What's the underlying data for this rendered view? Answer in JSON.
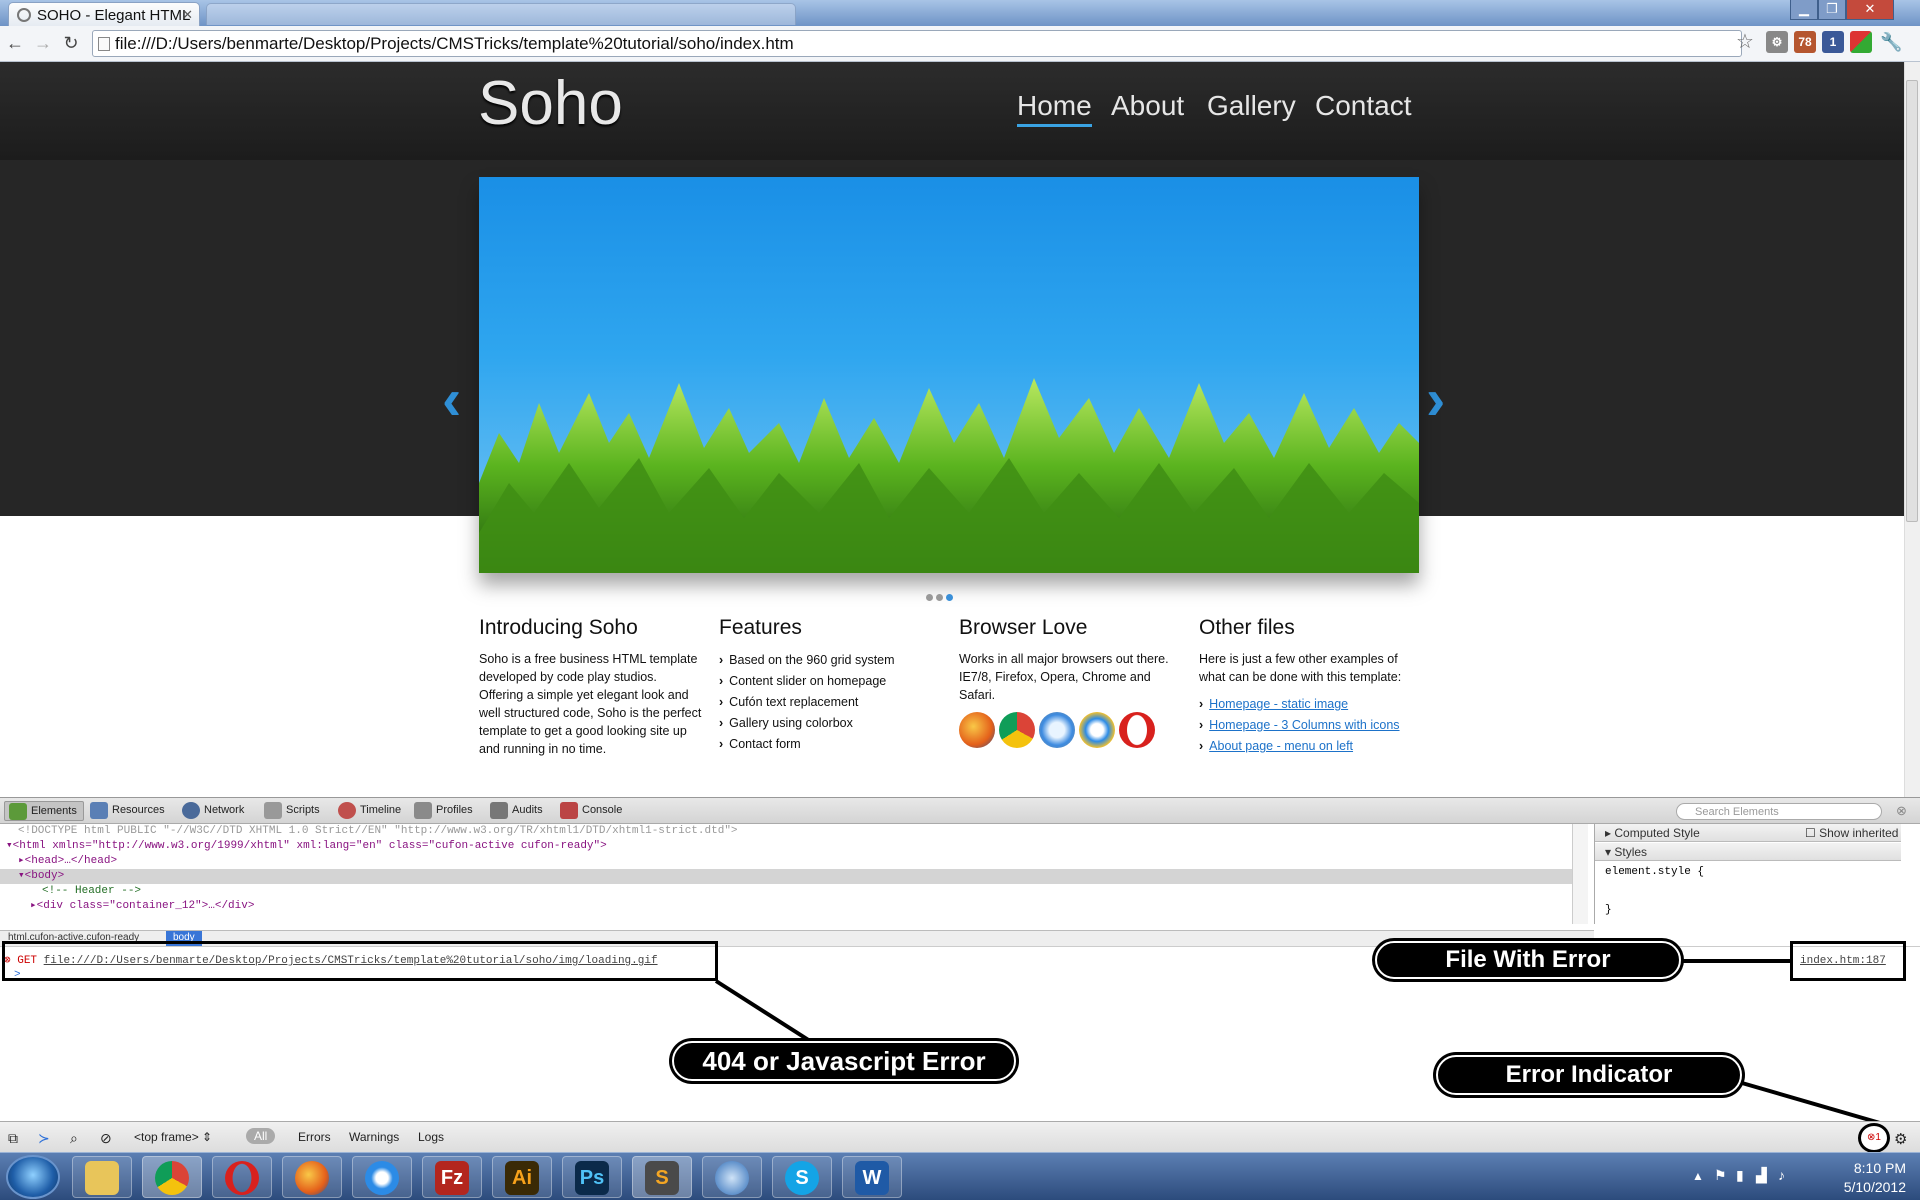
{
  "browser": {
    "tabs": [
      {
        "title": "SOHO - Elegant HTML"
      },
      {
        "title": ""
      }
    ],
    "window_controls": [
      "minimize",
      "maximize",
      "close"
    ],
    "url": "file:///D:/Users/benmarte/Desktop/Projects/CMSTricks/template%20tutorial/soho/index.htm",
    "extensions": [
      {
        "icon": "gear-icon"
      },
      {
        "icon": "extension-icon",
        "badge": "78"
      },
      {
        "icon": "facebook-icon",
        "badge": "1"
      },
      {
        "icon": "extension-icon"
      },
      {
        "icon": "wrench-icon"
      }
    ]
  },
  "site": {
    "logo": "Soho",
    "nav": [
      "Home",
      "About",
      "Gallery",
      "Contact"
    ],
    "columns": [
      {
        "title": "Introducing Soho",
        "text": "Soho is a free business HTML template developed by code play studios. Offering a simple yet elegant look and well structured code, Soho is the perfect template to get a good looking site up and running in no time."
      },
      {
        "title": "Features",
        "items": [
          "Based on the 960 grid system",
          "Content slider on homepage",
          "Cufón text replacement",
          "Gallery using colorbox",
          "Contact form"
        ]
      },
      {
        "title": "Browser Love",
        "text": "Works in all major browsers out there. IE7/8, Firefox, Opera, Chrome and Safari.",
        "browsers": [
          "firefox-icon",
          "chrome-icon",
          "safari-icon",
          "ie-icon",
          "opera-icon"
        ]
      },
      {
        "title": "Other files",
        "text": "Here is just a few other examples of what can be done with this template:",
        "links": [
          "Homepage - static image",
          "Homepage - 3 Columns with icons",
          "About page - menu on left"
        ]
      }
    ]
  },
  "devtools": {
    "tabs": [
      "Elements",
      "Resources",
      "Network",
      "Scripts",
      "Timeline",
      "Profiles",
      "Audits",
      "Console"
    ],
    "search_placeholder": "Search Elements",
    "dom": {
      "doctype": "<!DOCTYPE html PUBLIC \"-//W3C//DTD XHTML 1.0 Strict//EN\" \"http://www.w3.org/TR/xhtml1/DTD/xhtml1-strict.dtd\">",
      "html_open": "<html xmlns=\"http://www.w3.org/1999/xhtml\" xml:lang=\"en\" class=\"cufon-active cufon-ready\">",
      "head": "<head>…</head>",
      "body": "<body>",
      "comment": "<!-- Header -->",
      "div": "<div class=\"container_12\">…</div>"
    },
    "side": {
      "computed": "Computed Style",
      "show_inherited": "Show inherited",
      "styles": "Styles",
      "element_style_open": "element.style {",
      "element_style_close": "}"
    },
    "crumbs": {
      "html": "html.cufon-active.cufon-ready",
      "body": "body"
    },
    "console": {
      "method": "GET",
      "error_url": "file:///D:/Users/benmarte/Desktop/Projects/CMSTricks/template%20tutorial/soho/img/loading.gif",
      "source": "index.htm:187",
      "prompt": ">"
    },
    "status": {
      "frame": "<top frame>",
      "filters": [
        "All",
        "Errors",
        "Warnings",
        "Logs"
      ],
      "error_count": "1"
    }
  },
  "annotations": {
    "file": "File With Error",
    "js": "404 or Javascript Error",
    "indicator": "Error Indicator"
  },
  "taskbar": {
    "apps": [
      "explorer-icon",
      "chrome-icon",
      "opera-icon",
      "firefox-icon",
      "ie-icon",
      "filezilla-icon",
      "illustrator-icon",
      "photoshop-icon",
      "sublime-icon",
      "thunderbird-icon",
      "skype-icon",
      "word-icon"
    ],
    "app_labels": {
      "illustrator": "Ai",
      "photoshop": "Ps",
      "sublime": "S",
      "word": "W",
      "filezilla": "Fz"
    },
    "time": "8:10 PM",
    "date": "5/10/2012"
  }
}
